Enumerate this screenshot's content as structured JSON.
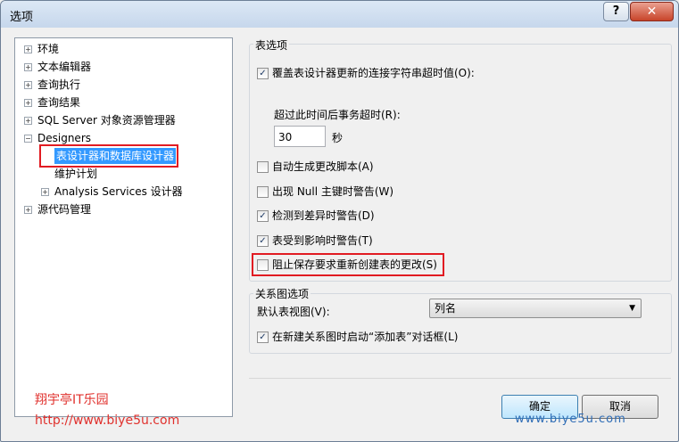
{
  "dialog": {
    "title": "选项",
    "help": "?",
    "close": "✕"
  },
  "tree": {
    "items": [
      "环境",
      "文本编辑器",
      "查询执行",
      "查询结果",
      "SQL Server 对象资源管理器",
      "Designers",
      "表设计器和数据库设计器",
      "维护计划",
      "Analysis Services 设计器",
      "源代码管理"
    ],
    "expander_plus": "+",
    "expander_minus": "−"
  },
  "watermark": {
    "title": "翔宇亭IT乐园",
    "url": "http://www.biye5u.com",
    "bottom": "www.biye5u.com"
  },
  "table_options": {
    "caption": "表选项",
    "override_timeout": {
      "label": "覆盖表设计器更新的连接字符串超时值(O):",
      "checked": true
    },
    "timeout_label": "超过此时间后事务超时(R):",
    "timeout_value": "30",
    "timeout_unit": "秒",
    "auto_script": {
      "label": "自动生成更改脚本(A)",
      "checked": false
    },
    "null_pk_warn": {
      "label": "出现 Null 主键时警告(W)",
      "checked": false
    },
    "diff_warn": {
      "label": "检测到差异时警告(D)",
      "checked": true
    },
    "affected_warn": {
      "label": "表受到影响时警告(T)",
      "checked": true
    },
    "prevent_save": {
      "label": "阻止保存要求重新创建表的更改(S)",
      "checked": false
    }
  },
  "diagram_options": {
    "caption": "关系图选项",
    "default_view_label": "默认表视图(V):",
    "default_view_value": "列名",
    "add_table_dialog": {
      "label": "在新建关系图时启动“添加表”对话框(L)",
      "checked": true
    }
  },
  "buttons": {
    "ok": "确定",
    "cancel": "取消"
  },
  "check_glyph": "✓"
}
